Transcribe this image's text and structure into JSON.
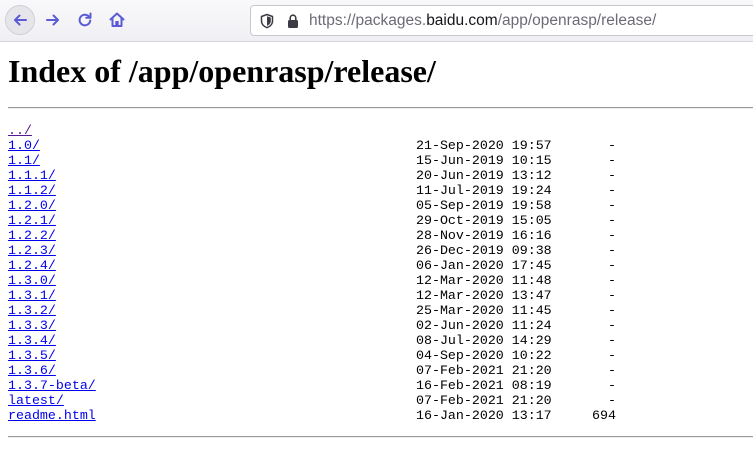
{
  "browser": {
    "url_prefix": "https://packages.",
    "url_host": "baidu.com",
    "url_path": "/app/openrasp/release/",
    "icons": {
      "back": "arrow-left-icon",
      "forward": "arrow-right-icon",
      "reload": "reload-icon",
      "home": "home-icon",
      "shield": "tracking-protection-shield-icon",
      "lock": "lock-icon"
    },
    "accent": "#5b5bd6"
  },
  "page": {
    "heading": "Index of /app/openrasp/release/",
    "entries": [
      {
        "name": "../",
        "date": "",
        "size": ""
      },
      {
        "name": "1.0/",
        "date": "21-Sep-2020 19:57",
        "size": "-"
      },
      {
        "name": "1.1/",
        "date": "15-Jun-2019 10:15",
        "size": "-"
      },
      {
        "name": "1.1.1/",
        "date": "20-Jun-2019 13:12",
        "size": "-"
      },
      {
        "name": "1.1.2/",
        "date": "11-Jul-2019 19:24",
        "size": "-"
      },
      {
        "name": "1.2.0/",
        "date": "05-Sep-2019 19:58",
        "size": "-"
      },
      {
        "name": "1.2.1/",
        "date": "29-Oct-2019 15:05",
        "size": "-"
      },
      {
        "name": "1.2.2/",
        "date": "28-Nov-2019 16:16",
        "size": "-"
      },
      {
        "name": "1.2.3/",
        "date": "26-Dec-2019 09:38",
        "size": "-"
      },
      {
        "name": "1.2.4/",
        "date": "06-Jan-2020 17:45",
        "size": "-"
      },
      {
        "name": "1.3.0/",
        "date": "12-Mar-2020 11:48",
        "size": "-"
      },
      {
        "name": "1.3.1/",
        "date": "12-Mar-2020 13:47",
        "size": "-"
      },
      {
        "name": "1.3.2/",
        "date": "25-Mar-2020 11:45",
        "size": "-"
      },
      {
        "name": "1.3.3/",
        "date": "02-Jun-2020 11:24",
        "size": "-"
      },
      {
        "name": "1.3.4/",
        "date": "08-Jul-2020 14:29",
        "size": "-"
      },
      {
        "name": "1.3.5/",
        "date": "04-Sep-2020 10:22",
        "size": "-"
      },
      {
        "name": "1.3.6/",
        "date": "07-Feb-2021 21:20",
        "size": "-"
      },
      {
        "name": "1.3.7-beta/",
        "date": "16-Feb-2021 08:19",
        "size": "-"
      },
      {
        "name": "latest/",
        "date": "07-Feb-2021 21:20",
        "size": "-"
      },
      {
        "name": "readme.html",
        "date": "16-Jan-2020 13:17",
        "size": "694"
      }
    ],
    "link_color": "#0000ee",
    "visited_link_color": "#551a8b"
  }
}
